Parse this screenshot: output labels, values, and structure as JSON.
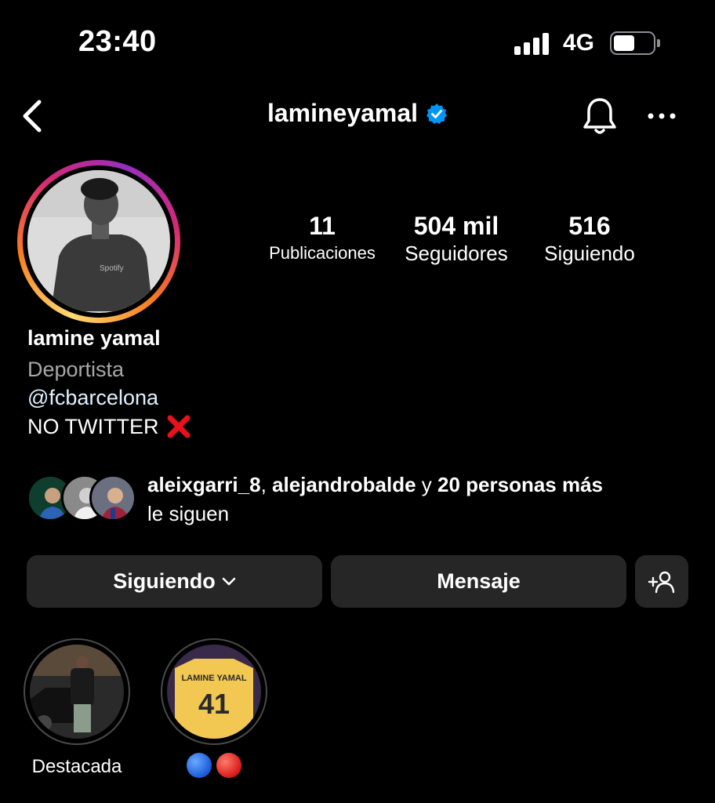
{
  "status_bar": {
    "time": "23:40",
    "network": "4G",
    "battery_level": 0.55,
    "icons": [
      "signal-icon",
      "battery-icon"
    ]
  },
  "header": {
    "username": "lamineyamal",
    "verified": true,
    "icons": [
      "chevron-left-icon",
      "verified-badge-icon",
      "bell-icon",
      "more-icon"
    ]
  },
  "stats": {
    "posts": {
      "value": "11",
      "label": "Publicaciones"
    },
    "followers": {
      "value": "504 mil",
      "label": "Seguidores"
    },
    "following": {
      "value": "516",
      "label": "Siguiendo"
    }
  },
  "bio": {
    "name": "lamine yamal",
    "category": "Deportista",
    "link": "@fcbarcelona",
    "text": "NO TWITTER",
    "emoji": "cross-mark-icon"
  },
  "mutuals": {
    "user1": "aleixgarri_8",
    "separator": ",",
    "user2": "alejandrobalde",
    "connector": "y",
    "others": "20 personas más",
    "suffix": "le siguen"
  },
  "actions": {
    "following_label": "Siguiendo",
    "message_label": "Mensaje",
    "icons": [
      "chevron-down-icon",
      "add-person-icon"
    ]
  },
  "highlights": [
    {
      "label": "Destacada"
    },
    {
      "label": "",
      "emoji": [
        "blue-circle-icon",
        "red-circle-icon"
      ]
    }
  ],
  "colors": {
    "background": "#000000",
    "button_bg": "#262626",
    "secondary_text": "#a8a8a8",
    "link_text": "#e0f1ff",
    "verified_blue": "#0095f6",
    "cross_red": "#e8111b"
  }
}
